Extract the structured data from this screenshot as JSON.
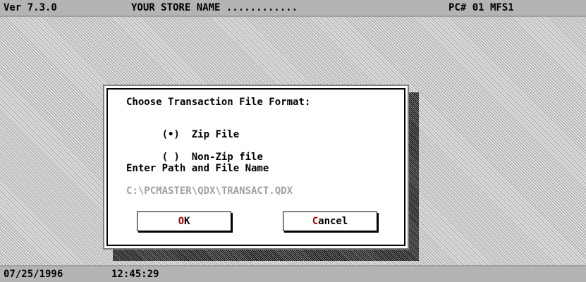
{
  "header": {
    "version": "Ver 7.3.0",
    "store_name": "YOUR STORE NAME ............",
    "pc_id": "PC# 01 MFS1"
  },
  "dialog": {
    "title": "Choose Transaction File Format:",
    "options": [
      {
        "marker": "(•)",
        "label": "Zip File",
        "selected": true
      },
      {
        "marker": "( )",
        "label": "Non-Zip file",
        "selected": false
      }
    ],
    "path_label": "Enter Path and File Name",
    "path_value": "C:\\PCMASTER\\QDX\\TRANSACT.QDX",
    "ok_button": {
      "hotkey": "O",
      "rest": "K"
    },
    "cancel_button": {
      "hotkey": "C",
      "rest": "ancel"
    }
  },
  "footer": {
    "date": "07/25/1996",
    "time": "12:45:29"
  }
}
